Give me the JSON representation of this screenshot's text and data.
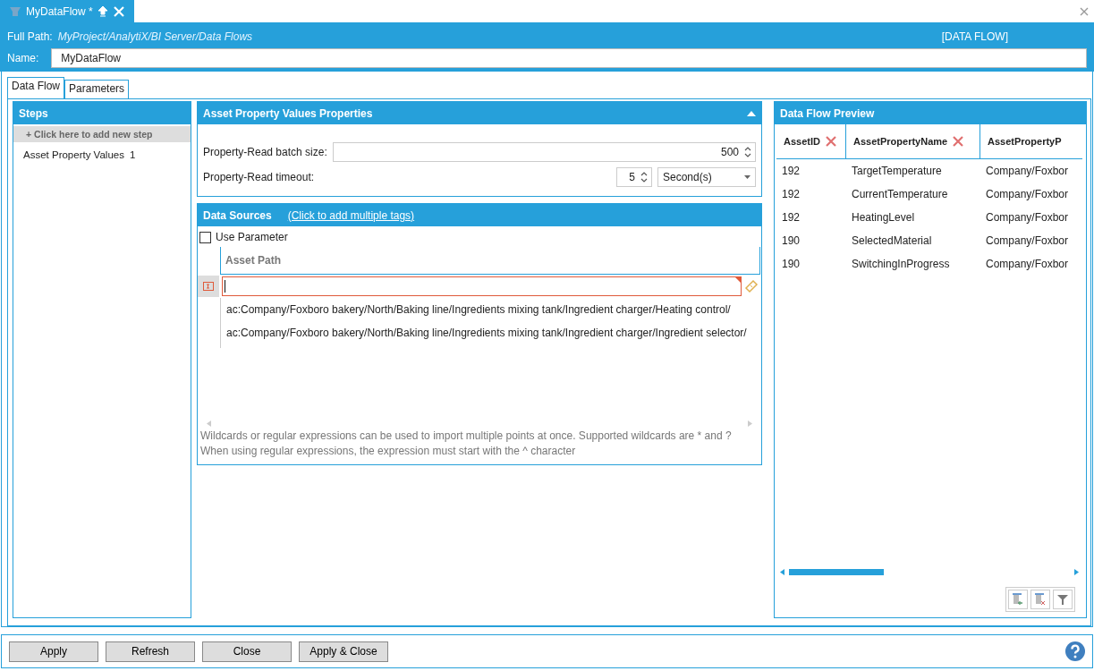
{
  "document_tab": {
    "title": "MyDataFlow *"
  },
  "header": {
    "path_label": "Full Path:",
    "path": "MyProject/AnalytiX/BI Server/Data Flows",
    "kind": "[DATA FLOW]",
    "name_label": "Name:",
    "name": "MyDataFlow"
  },
  "tabs": [
    {
      "label": "Data Flow",
      "selected": true
    },
    {
      "label": "Parameters",
      "selected": false
    }
  ],
  "steps": {
    "title": "Steps",
    "add_step": "+  Click here to add new step",
    "items": [
      {
        "label": "Asset Property Values",
        "count": "1"
      }
    ]
  },
  "properties": {
    "title": "Asset Property Values Properties",
    "batch_label": "Property-Read batch size:",
    "batch_value": "500",
    "timeout_label": "Property-Read timeout:",
    "timeout_value": "5",
    "timeout_unit": "Second(s)"
  },
  "data_sources": {
    "title": "Data Sources",
    "link": "(Click to add multiple tags)",
    "use_parameter": {
      "label": "Use Parameter",
      "checked": false
    },
    "column": "Asset Path",
    "rows": [
      "ac:Company/Foxboro bakery/North/Baking line/Ingredients mixing tank/Ingredient charger/Heating control/",
      "ac:Company/Foxboro bakery/North/Baking line/Ingredients mixing tank/Ingredient charger/Ingredient selector/"
    ],
    "hint": "Wildcards or regular expressions can be used to import multiple points at once. Supported wildcards are * and ? When using regular expressions, the expression must start with the ^ character"
  },
  "preview": {
    "title": "Data Flow Preview",
    "columns": [
      {
        "label": "AssetID",
        "removable": true
      },
      {
        "label": "AssetPropertyName",
        "removable": true
      },
      {
        "label": "AssetPropertyP",
        "removable": false
      }
    ],
    "rows": [
      [
        "192",
        "TargetTemperature",
        "Company/Foxbor"
      ],
      [
        "192",
        "CurrentTemperature",
        "Company/Foxbor"
      ],
      [
        "192",
        "HeatingLevel",
        "Company/Foxbor"
      ],
      [
        "190",
        "SelectedMaterial",
        "Company/Foxbor"
      ],
      [
        "190",
        "SwitchingInProgress",
        "Company/Foxbor"
      ]
    ]
  },
  "buttons": [
    "Apply",
    "Refresh",
    "Close",
    "Apply & Close"
  ]
}
